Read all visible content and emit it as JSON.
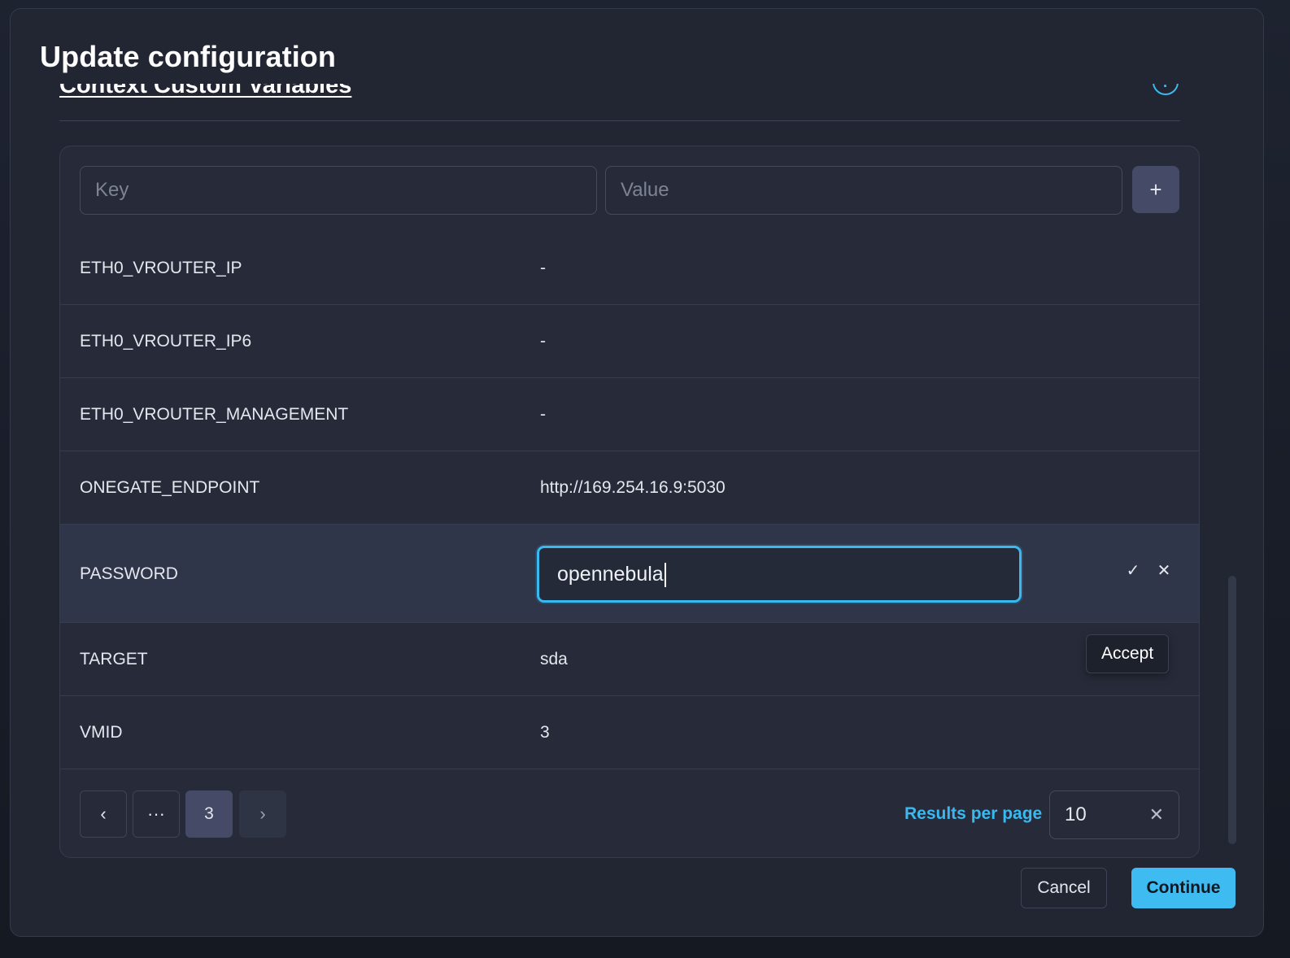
{
  "modal": {
    "title": "Update configuration",
    "section_title": "Context Custom Variables",
    "help_icon": "?",
    "collapse_icon": "^"
  },
  "new_variable": {
    "key_placeholder": "Key",
    "value_placeholder": "Value",
    "add_label": "+"
  },
  "variables": [
    {
      "key": "ETH0_VROUTER_IP",
      "value": "-"
    },
    {
      "key": "ETH0_VROUTER_IP6",
      "value": "-"
    },
    {
      "key": "ETH0_VROUTER_MANAGEMENT",
      "value": "-"
    },
    {
      "key": "ONEGATE_ENDPOINT",
      "value": "http://169.254.16.9:5030"
    },
    {
      "key": "PASSWORD",
      "value": "opennebula",
      "editing": true
    },
    {
      "key": "TARGET",
      "value": "sda"
    },
    {
      "key": "VMID",
      "value": "3"
    }
  ],
  "edit_actions": {
    "accept_icon": "✓",
    "cancel_icon": "✕",
    "tooltip": "Accept"
  },
  "pagination": {
    "prev_icon": "‹",
    "ellipsis": "···",
    "current_page": "3",
    "next_icon": "›",
    "results_per_page_label": "Results per page",
    "results_per_page_value": "10",
    "clear_icon": "✕"
  },
  "footer": {
    "cancel_label": "Cancel",
    "continue_label": "Continue"
  },
  "colors": {
    "accent": "#3ab8f0",
    "modal_bg": "#222633",
    "card_bg": "#272b39"
  }
}
